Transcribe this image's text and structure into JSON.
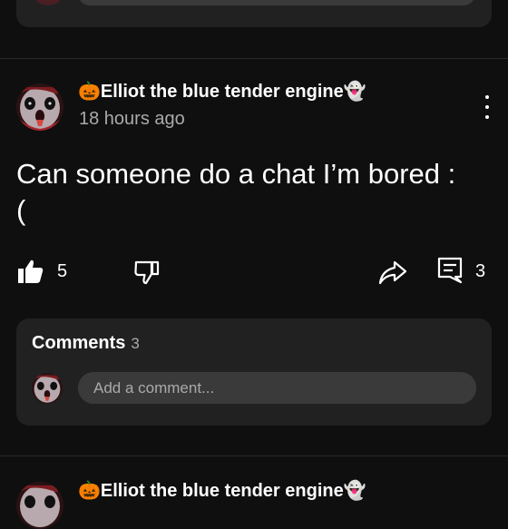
{
  "previous_post": {
    "comment_placeholder": ""
  },
  "post": {
    "author": {
      "prefix_emoji": "🎃",
      "name": "Elliot the blue tender engine",
      "suffix_emoji": "👻"
    },
    "timestamp": "18 hours ago",
    "text": "Can someone do a chat I’m bored :\n(",
    "likes": "5",
    "comments_count": "3",
    "icons": {
      "like": "thumbs-up-icon",
      "dislike": "thumbs-down-icon",
      "share": "share-icon",
      "comments": "comment-icon",
      "menu": "more-vertical-icon"
    }
  },
  "comments_section": {
    "title": "Comments",
    "count": "3",
    "input_placeholder": "Add a comment..."
  },
  "next_post": {
    "author": {
      "prefix_emoji": "🎃",
      "name": "Elliot the blue tender engine",
      "suffix_emoji": "👻"
    }
  },
  "colors": {
    "background": "#0f0f0f",
    "card": "#212121",
    "input": "#3a3a3a",
    "text_primary": "#ffffff",
    "text_secondary": "#aaaaaa"
  }
}
